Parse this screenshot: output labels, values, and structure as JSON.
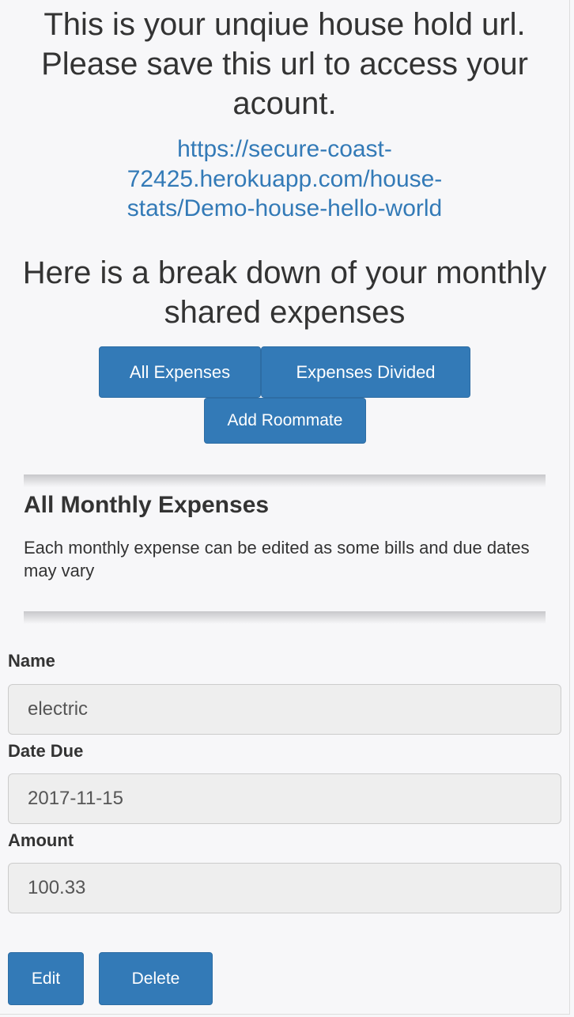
{
  "header": {
    "title": "This is your unqiue house hold url. Please save this url to access your acount.",
    "url": "https://secure-coast-72425.herokuapp.com/house-stats/Demo-house-hello-world",
    "subtitle": "Here is a break down of your monthly shared expenses"
  },
  "nav": {
    "all_expenses": "All Expenses",
    "expenses_divided": "Expenses Divided",
    "add_roommate": "Add Roommate"
  },
  "section": {
    "title": "All Monthly Expenses",
    "description": "Each monthly expense can be edited as some bills and due dates may vary"
  },
  "expense": {
    "name_label": "Name",
    "name_value": "electric",
    "date_label": "Date Due",
    "date_value": "2017-11-15",
    "amount_label": "Amount",
    "amount_value": "100.33"
  },
  "actions": {
    "edit": "Edit",
    "delete": "Delete"
  },
  "colors": {
    "primary": "#337ab7",
    "link": "#337ab7",
    "background": "#f7f7f9"
  }
}
